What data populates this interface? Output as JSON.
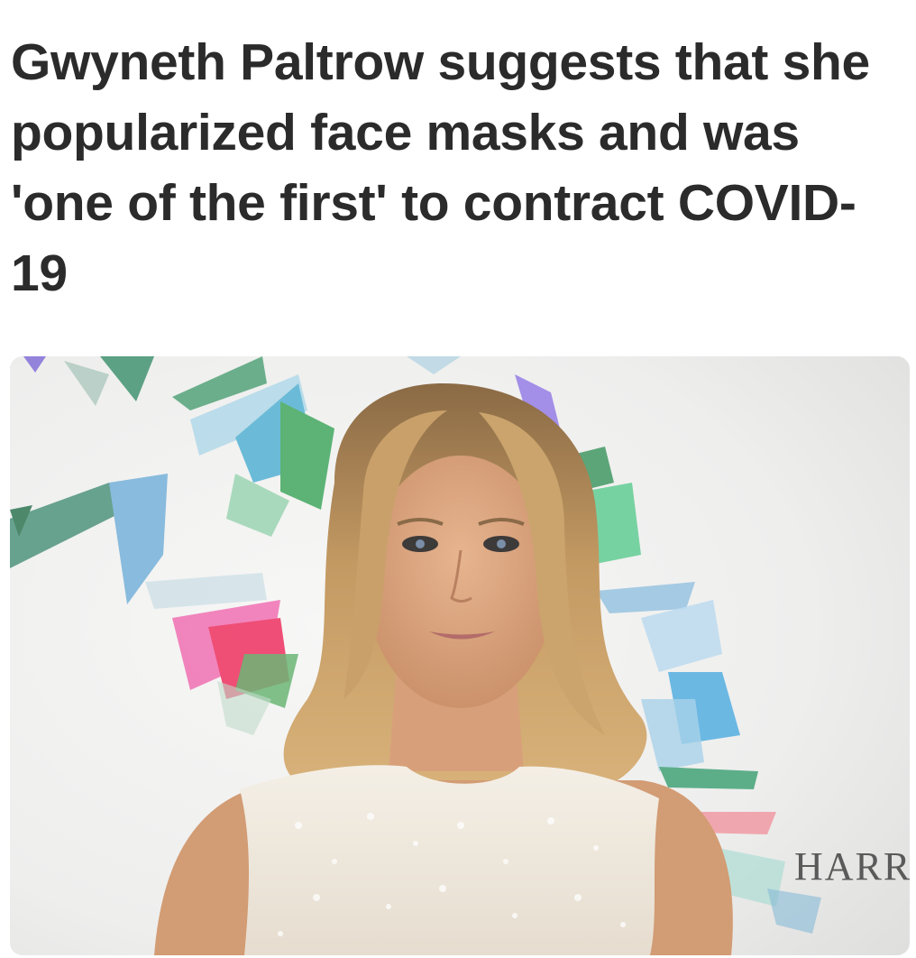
{
  "article": {
    "headline": "Gwyneth Paltrow suggests that she popularized face masks and was 'one of the first' to contract COVID-19"
  },
  "photo": {
    "backdrop_text": "HARR"
  }
}
